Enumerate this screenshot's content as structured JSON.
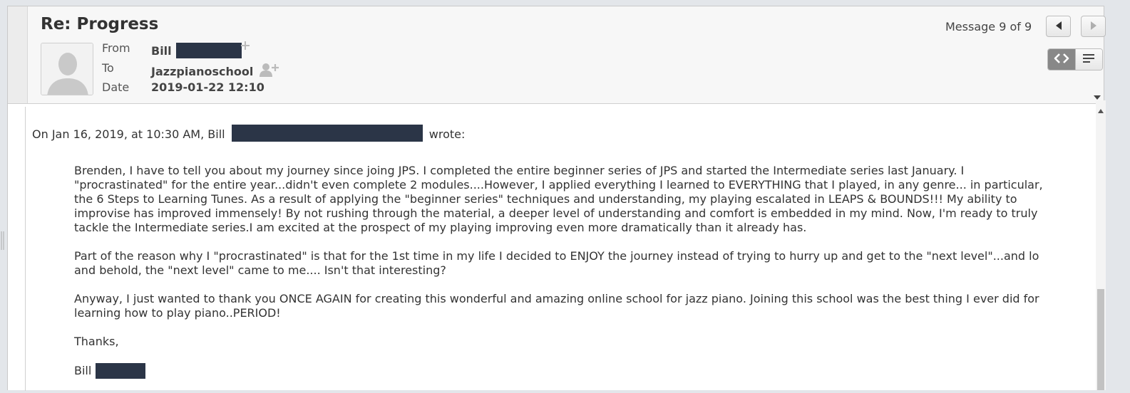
{
  "message": {
    "subject": "Re: Progress",
    "counter": "Message 9 of 9",
    "from_label": "From",
    "from_name": "Bill",
    "to_label": "To",
    "to_name": "Jazzpianoschool",
    "date_label": "Date",
    "date_value": "2019-01-22 12:10"
  },
  "body": {
    "intro_prefix": "On Jan 16, 2019, at 10:30 AM, Bill",
    "intro_suffix": "wrote:",
    "paragraphs": [
      "Brenden, I have to tell you about my journey since joing JPS. I completed the entire beginner series of JPS and started the Intermediate series last January. I \"procrastinated\" for the entire year...didn't even complete 2 modules....However, I applied everything I learned to EVERYTHING that I played, in any genre... in particular, the 6 Steps to Learning Tunes. As a result of applying the \"beginner series\" techniques and understanding, my playing escalated in LEAPS & BOUNDS!!! My ability to improvise has improved immensely! By not rushing through the material, a deeper level of understanding and comfort is embedded in my mind. Now, I'm ready to truly tackle the Intermediate series.I am excited at the prospect of my playing improving even more dramatically than it already has.",
      "Part of the reason why I \"procrastinated\" is that for the 1st time in my life I decided to ENJOY  the journey instead of trying to hurry up and get to the \"next level\"...and lo and behold, the \"next level\" came to me....  Isn't that interesting?",
      "Anyway, I just wanted to thank you ONCE AGAIN for creating this wonderful and amazing online school for jazz piano. Joining this school was the best thing I ever did for learning how to play piano..PERIOD!",
      "Thanks,"
    ],
    "signature": "Bill"
  },
  "icons": {
    "prev": "chevron-left-icon",
    "next": "chevron-right-icon",
    "html_view": "code-view-icon",
    "plain_view": "text-lines-icon",
    "add_contact": "add-contact-icon",
    "avatar": "person-placeholder-icon",
    "expand": "caret-down-icon"
  },
  "colors": {
    "redaction": "#2b3547",
    "toggle_active": "#888888"
  }
}
